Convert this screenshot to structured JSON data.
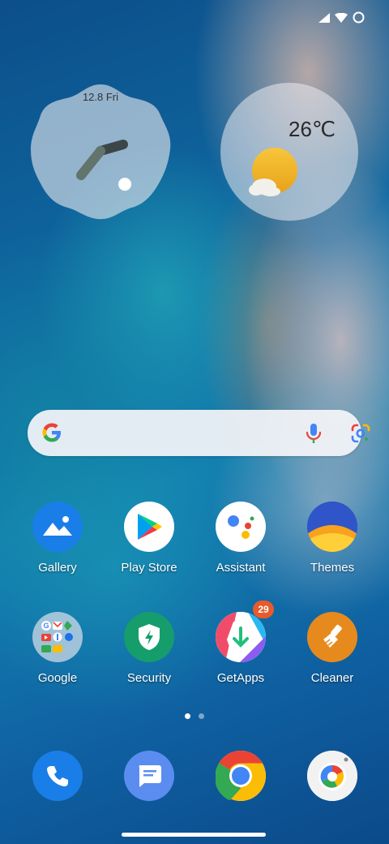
{
  "status_bar": {
    "icons": [
      "signal-icon",
      "wifi-icon",
      "battery-icon"
    ]
  },
  "clock_widget": {
    "date": "12.8 Fri"
  },
  "weather_widget": {
    "temperature": "26℃",
    "icon": "partly-sunny-icon"
  },
  "search_bar": {
    "icons": [
      "google-g-icon",
      "microphone-icon",
      "google-lens-icon"
    ]
  },
  "apps_row1": [
    {
      "label": "Gallery",
      "icon": "gallery-icon"
    },
    {
      "label": "Play Store",
      "icon": "play-store-icon"
    },
    {
      "label": "Assistant",
      "icon": "assistant-icon"
    },
    {
      "label": "Themes",
      "icon": "themes-icon"
    }
  ],
  "apps_row2": [
    {
      "label": "Google",
      "icon": "google-folder-icon"
    },
    {
      "label": "Security",
      "icon": "security-icon"
    },
    {
      "label": "GetApps",
      "icon": "getapps-icon",
      "badge": "29"
    },
    {
      "label": "Cleaner",
      "icon": "cleaner-icon"
    }
  ],
  "page_indicator": {
    "pages": 2,
    "current": 1
  },
  "dock": [
    {
      "icon": "phone-icon"
    },
    {
      "icon": "messages-icon"
    },
    {
      "icon": "chrome-icon"
    },
    {
      "icon": "camera-icon"
    }
  ],
  "colors": {
    "accent_blue": "#1a7ee8",
    "badge_orange": "#e85a2c",
    "security_green": "#169d6c",
    "cleaner_orange": "#e68a1e"
  }
}
